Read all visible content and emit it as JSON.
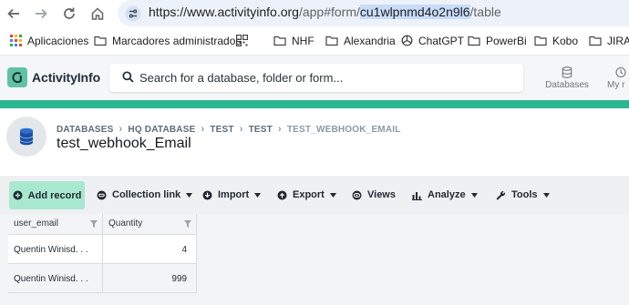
{
  "browser": {
    "url_host": "https://www.activityinfo.org",
    "url_path_pre": "/app#form/",
    "url_path_hl": "cu1wlpnmd4o2n9l6",
    "url_path_post": "/table",
    "bookmarks": [
      {
        "label": "Aplicaciones",
        "icon": "apps-grid-icon"
      },
      {
        "label": "Marcadores administrados",
        "icon": "folder-icon"
      },
      {
        "label": "",
        "icon": "qr-icon"
      },
      {
        "label": "NHF",
        "icon": "folder-icon"
      },
      {
        "label": "Alexandria",
        "icon": "folder-icon"
      },
      {
        "label": "ChatGPT",
        "icon": "openai-icon"
      },
      {
        "label": "PowerBi",
        "icon": "folder-icon"
      },
      {
        "label": "Kobo",
        "icon": "folder-icon"
      },
      {
        "label": "JIRA",
        "icon": "folder-icon"
      }
    ]
  },
  "app": {
    "name": "ActivityInfo",
    "search_placeholder": "Search for a database, folder or form...",
    "databases_label": "Databases",
    "my_label": "My r",
    "accent_color": "#2cb592"
  },
  "page": {
    "breadcrumb": [
      "DATABASES",
      "HQ DATABASE",
      "TEST",
      "TEST",
      "TEST_WEBHOOK_EMAIL"
    ],
    "title": "test_webhook_Email"
  },
  "toolbar": {
    "add_record": "Add record",
    "collection_link": "Collection link",
    "import": "Import",
    "export": "Export",
    "views": "Views",
    "analyze": "Analyze",
    "tools": "Tools"
  },
  "table": {
    "columns": [
      "user_email",
      "Quantity"
    ],
    "rows": [
      {
        "user_email": "Quentin Winisd. . .",
        "quantity": "4"
      },
      {
        "user_email": "Quentin Winisd. . .",
        "quantity": "999"
      }
    ]
  }
}
